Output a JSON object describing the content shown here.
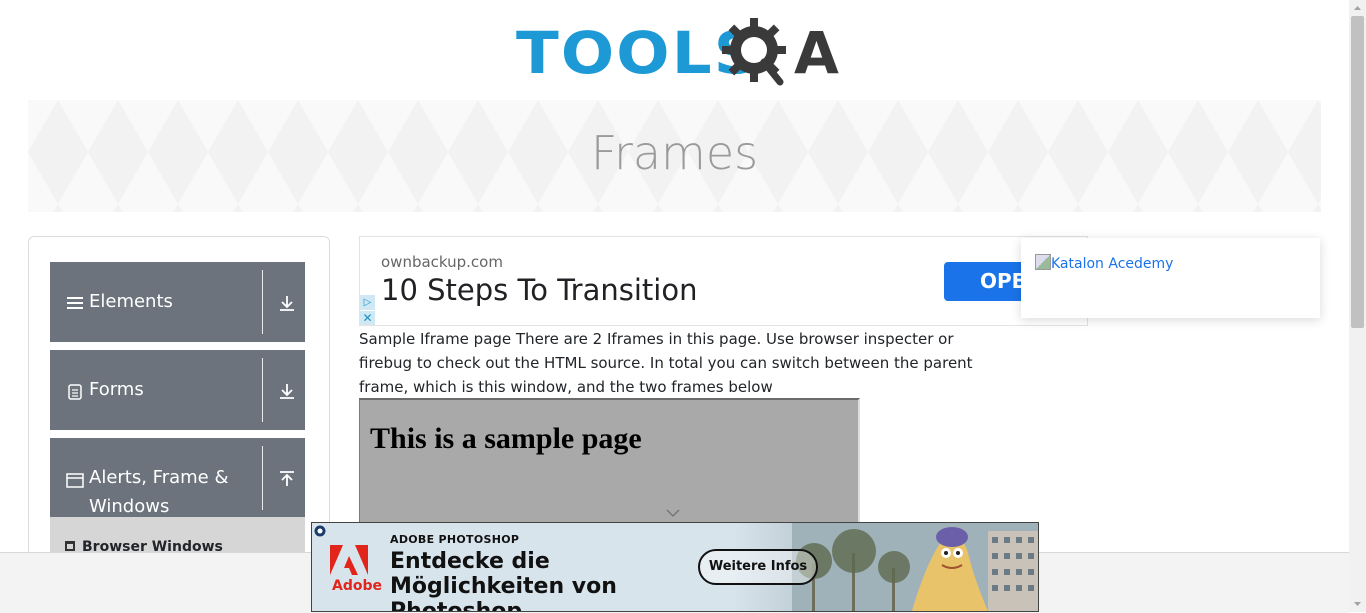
{
  "header": {
    "logo_text": "TOOLS",
    "logo_suffix": "A"
  },
  "banner": {
    "title": "Frames"
  },
  "sidebar": {
    "groups": [
      {
        "label": "Elements",
        "icon": "hamburger-icon",
        "arrow": "download-arrow-icon"
      },
      {
        "label": "Forms",
        "icon": "document-icon",
        "arrow": "download-arrow-icon"
      },
      {
        "label": "Alerts, Frame &",
        "label2": "Windows",
        "icon": "window-icon",
        "arrow": "upload-arrow-icon"
      }
    ],
    "sub_items": [
      {
        "label": "Browser Windows",
        "icon": "browser-icon"
      }
    ]
  },
  "ad_top": {
    "domain": "ownbackup.com",
    "headline": "10 Steps To Transition",
    "button_label": "OPE",
    "choices_glyph": "▷",
    "close_glyph": "✕"
  },
  "side_card": {
    "alt_text": "Katalon Acedemy"
  },
  "content": {
    "description": "Sample Iframe page There are 2 Iframes in this page. Use browser inspecter or firebug to check out the HTML source. In total you can switch between the parent frame, which is this window, and the two frames below"
  },
  "frame": {
    "heading": "This is a sample page"
  },
  "ad_bottom": {
    "brand": "Adobe",
    "eyebrow": "ADOBE PHOTOSHOP",
    "headline": "Entdecke die Möglichkeiten von Photoshop.",
    "button_label": "Weitere Infos",
    "colors": {
      "adobe_red": "#e1251b"
    }
  },
  "colors": {
    "brand_blue": "#1d9ad6",
    "sidebar_gray": "#6c737c"
  }
}
